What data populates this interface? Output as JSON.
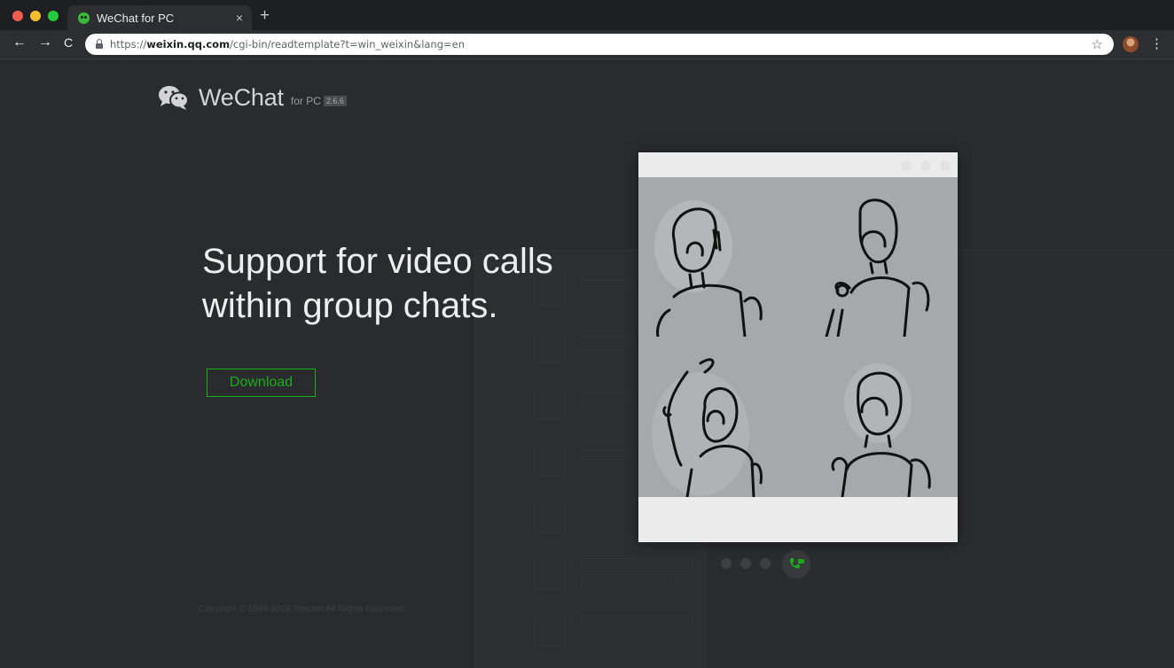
{
  "browser": {
    "tab_title": "WeChat for PC",
    "tab_close": "×",
    "new_tab": "+",
    "url_scheme": "https://",
    "url_host": "weixin.qq.com",
    "url_path": "/cgi-bin/readtemplate?t=win_weixin&lang=en",
    "back": "←",
    "forward": "→",
    "reload": "C",
    "star": "☆",
    "menu": "⋮",
    "traffic_colors": [
      "#ee5d52",
      "#f6be2f",
      "#27c93f"
    ]
  },
  "page": {
    "logo": {
      "name": "WeChat",
      "for": "for PC",
      "version": "2.6.6"
    },
    "headline": "Support for video calls within group chats.",
    "download_label": "Download",
    "copyright": "Copyright © 1998-2018 Tencent All Rights Reserved",
    "accent_color": "#1aad19"
  },
  "icons": {
    "logo": "wechat-logo-icon",
    "call": "video-call-icon",
    "lock": "lock-icon"
  }
}
